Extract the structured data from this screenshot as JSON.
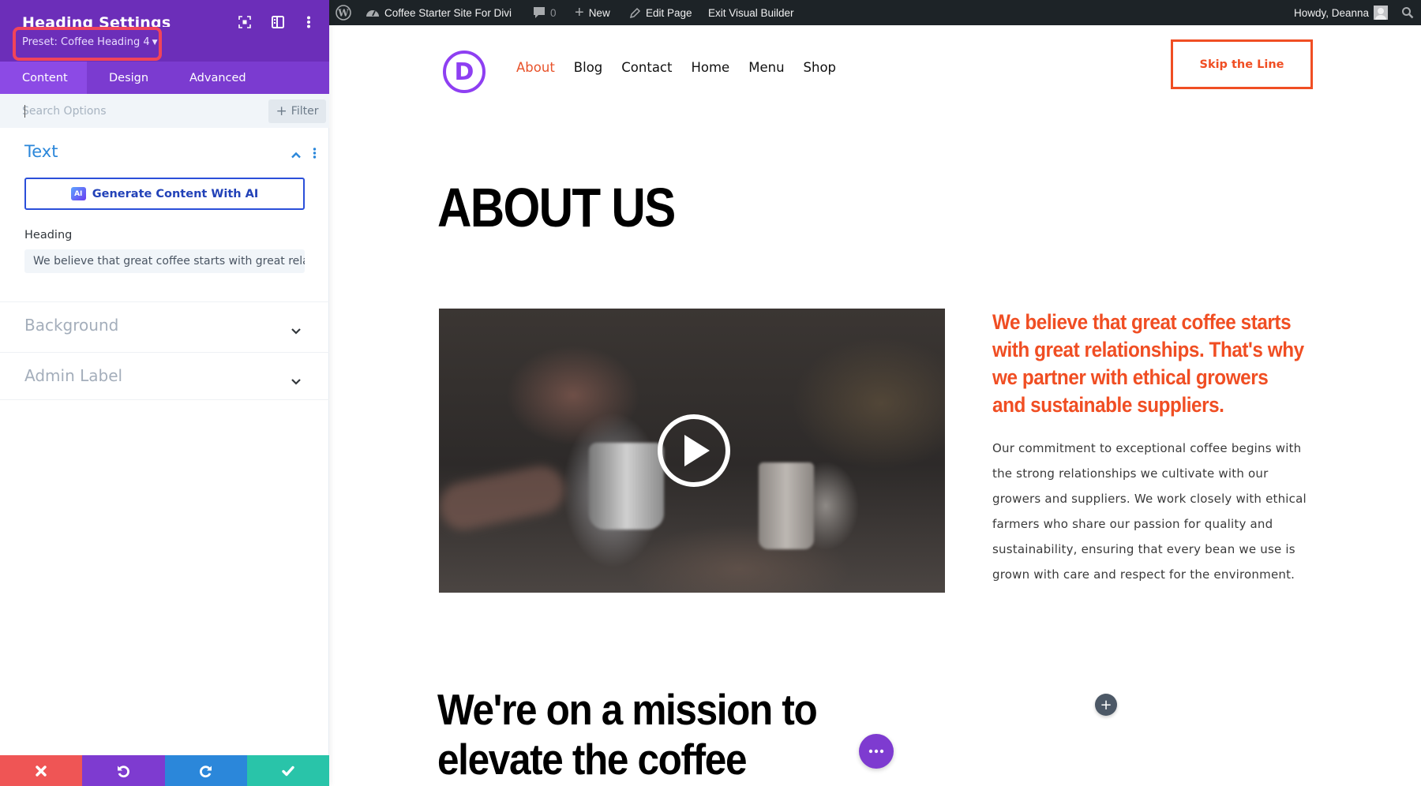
{
  "panel": {
    "title": "Heading Settings",
    "preset": "Preset: Coffee Heading 4",
    "header_icons": [
      "focus-icon",
      "split-view-icon",
      "more-vertical-icon"
    ],
    "tabs": [
      {
        "label": "Content",
        "active": true
      },
      {
        "label": "Design",
        "active": false
      },
      {
        "label": "Advanced",
        "active": false
      }
    ],
    "search": {
      "placeholder": "Search Options",
      "value": ""
    },
    "filter_label": "Filter",
    "sections": {
      "text": {
        "title": "Text",
        "expanded": true,
        "ai_badge": "AI",
        "ai_button": "Generate Content With AI",
        "heading_label": "Heading",
        "heading_value": "We believe that great coffee starts with great relati"
      },
      "background": {
        "title": "Background",
        "expanded": false
      },
      "admin_label": {
        "title": "Admin Label",
        "expanded": false
      }
    },
    "bottom_actions": [
      {
        "name": "cancel",
        "icon": "close-icon",
        "color": "#ef5555"
      },
      {
        "name": "undo",
        "icon": "undo-icon",
        "color": "#7e3bd0"
      },
      {
        "name": "redo",
        "icon": "redo-icon",
        "color": "#2b87da"
      },
      {
        "name": "save",
        "icon": "check-icon",
        "color": "#29c4a9"
      }
    ],
    "colors": {
      "header": "#6c2eb9",
      "tabs": "#7b3bd0",
      "active_tab": "#8c4ae5",
      "accent_blue": "#2b87da",
      "highlight": "#f1445a"
    }
  },
  "adminbar": {
    "site_name": "Coffee Starter Site For Divi",
    "comments_count": "0",
    "new_label": "New",
    "edit_label": "Edit Page",
    "exit_label": "Exit Visual Builder",
    "greeting": "Howdy, Deanna"
  },
  "site": {
    "logo_letter": "D",
    "nav": [
      {
        "label": "About",
        "active": true
      },
      {
        "label": "Blog",
        "active": false
      },
      {
        "label": "Contact",
        "active": false
      },
      {
        "label": "Home",
        "active": false
      },
      {
        "label": "Menu",
        "active": false
      },
      {
        "label": "Shop",
        "active": false
      }
    ],
    "cta": "Skip the Line",
    "page_title": "ABOUT US",
    "lead": "We believe that great coffee starts with great relationships. That's why we partner with ethical growers and sustainable suppliers.",
    "body": "Our commitment to exceptional coffee begins with the strong relationships we cultivate with our growers and suppliers. We work closely with ethical farmers who share our passion for quality and sustainability, ensuring that every bean we use is grown with care and respect for the environment.",
    "mission_heading": "We're on a mission to elevate the coffee",
    "colors": {
      "brand_orange": "#f04e23",
      "logo_purple": "#8e3ff2"
    }
  }
}
